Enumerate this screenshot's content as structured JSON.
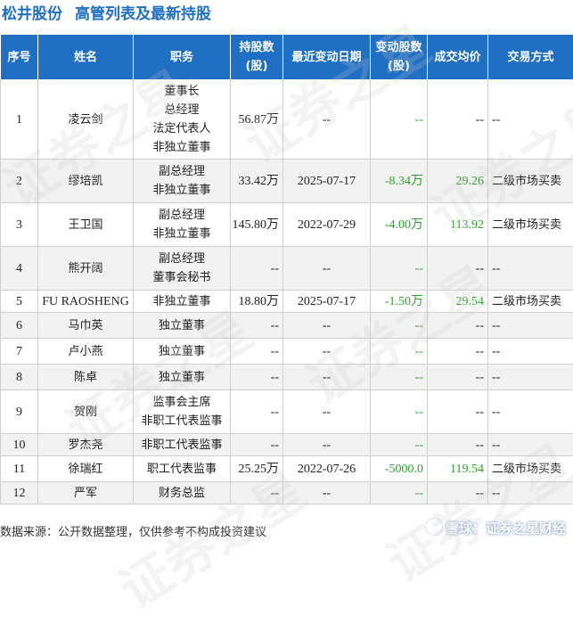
{
  "header": {
    "company": "松井股份",
    "title": "高管列表及最新持股"
  },
  "table": {
    "columns": [
      "序号",
      "姓名",
      "职务",
      "持股数\n(股)",
      "最近变动日期",
      "变动股数\n(股)",
      "成交均价",
      "交易方式"
    ],
    "rows": [
      {
        "seq": "1",
        "name": "凌云剑",
        "roles": [
          "董事长",
          "总经理",
          "法定代表人",
          "非独立董事"
        ],
        "shares": "56.87万",
        "date": "--",
        "change": "--",
        "price": "--",
        "method": "--"
      },
      {
        "seq": "2",
        "name": "缪培凯",
        "roles": [
          "副总经理",
          "非独立董事"
        ],
        "shares": "33.42万",
        "date": "2025-07-17",
        "change": "-8.34万",
        "price": "29.26",
        "method": "二级市场买卖"
      },
      {
        "seq": "3",
        "name": "王卫国",
        "roles": [
          "副总经理",
          "非独立董事"
        ],
        "shares": "145.80万",
        "date": "2022-07-29",
        "change": "-4.00万",
        "price": "113.92",
        "method": "二级市场买卖"
      },
      {
        "seq": "4",
        "name": "熊开阔",
        "roles": [
          "副总经理",
          "董事会秘书"
        ],
        "shares": "--",
        "date": "--",
        "change": "--",
        "price": "--",
        "method": "--"
      },
      {
        "seq": "5",
        "name": "FU RAOSHENG",
        "roles": [
          "非独立董事"
        ],
        "shares": "18.80万",
        "date": "2025-07-17",
        "change": "-1.50万",
        "price": "29.54",
        "method": "二级市场买卖"
      },
      {
        "seq": "6",
        "name": "马巾英",
        "roles": [
          "独立董事"
        ],
        "shares": "--",
        "date": "--",
        "change": "--",
        "price": "--",
        "method": "--"
      },
      {
        "seq": "7",
        "name": "卢小燕",
        "roles": [
          "独立董事"
        ],
        "shares": "--",
        "date": "--",
        "change": "--",
        "price": "--",
        "method": "--"
      },
      {
        "seq": "8",
        "name": "陈卓",
        "roles": [
          "独立董事"
        ],
        "shares": "--",
        "date": "--",
        "change": "--",
        "price": "--",
        "method": "--"
      },
      {
        "seq": "9",
        "name": "贺刚",
        "roles": [
          "监事会主席",
          "非职工代表监事"
        ],
        "shares": "--",
        "date": "--",
        "change": "--",
        "price": "--",
        "method": "--"
      },
      {
        "seq": "10",
        "name": "罗杰尧",
        "roles": [
          "非职工代表监事"
        ],
        "shares": "--",
        "date": "--",
        "change": "--",
        "price": "--",
        "method": "--"
      },
      {
        "seq": "11",
        "name": "徐瑞红",
        "roles": [
          "职工代表监事"
        ],
        "shares": "25.25万",
        "date": "2022-07-26",
        "change": "-5000.0",
        "price": "119.54",
        "method": "二级市场买卖"
      },
      {
        "seq": "12",
        "name": "严军",
        "roles": [
          "财务总监"
        ],
        "shares": "--",
        "date": "--",
        "change": "--",
        "price": "--",
        "method": "--"
      }
    ]
  },
  "footer": {
    "source": "数据来源：公开数据整理，仅供参考不构成投资建议"
  },
  "brand": {
    "text": "雪球：证券之星财经"
  },
  "watermark": {
    "text": "证券之星"
  },
  "colors": {
    "header_bg": "#1f6fc5",
    "title": "#1f6fc5",
    "negative": "#2aa32a",
    "row_alt": "#f2f2f2"
  }
}
